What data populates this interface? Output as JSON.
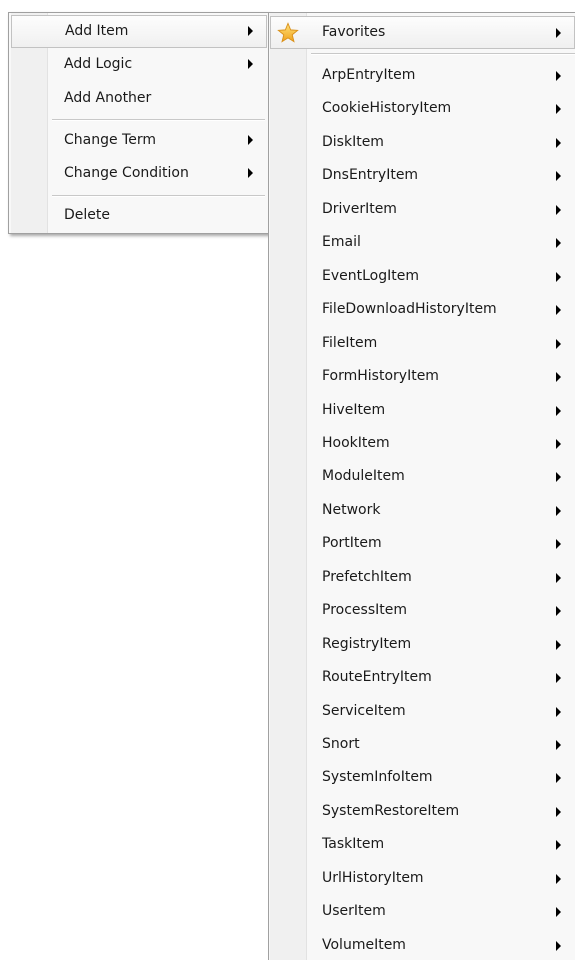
{
  "main_menu": {
    "items": [
      {
        "label": "Add Item"
      },
      {
        "label": "Add Logic"
      },
      {
        "label": "Add Another"
      },
      {
        "label": "Change Term"
      },
      {
        "label": "Change Condition"
      },
      {
        "label": "Delete"
      }
    ]
  },
  "sub_menu": {
    "favorites": {
      "label": "Favorites",
      "icon": "star-icon",
      "icon_color": "#f5c242"
    },
    "items": [
      {
        "label": "ArpEntryItem"
      },
      {
        "label": "CookieHistoryItem"
      },
      {
        "label": "DiskItem"
      },
      {
        "label": "DnsEntryItem"
      },
      {
        "label": "DriverItem"
      },
      {
        "label": "Email"
      },
      {
        "label": "EventLogItem"
      },
      {
        "label": "FileDownloadHistoryItem"
      },
      {
        "label": "FileItem"
      },
      {
        "label": "FormHistoryItem"
      },
      {
        "label": "HiveItem"
      },
      {
        "label": "HookItem"
      },
      {
        "label": "ModuleItem"
      },
      {
        "label": "Network"
      },
      {
        "label": "PortItem"
      },
      {
        "label": "PrefetchItem"
      },
      {
        "label": "ProcessItem"
      },
      {
        "label": "RegistryItem"
      },
      {
        "label": "RouteEntryItem"
      },
      {
        "label": "ServiceItem"
      },
      {
        "label": "Snort"
      },
      {
        "label": "SystemInfoItem"
      },
      {
        "label": "SystemRestoreItem"
      },
      {
        "label": "TaskItem"
      },
      {
        "label": "UrlHistoryItem"
      },
      {
        "label": "UserItem"
      },
      {
        "label": "VolumeItem"
      }
    ]
  }
}
